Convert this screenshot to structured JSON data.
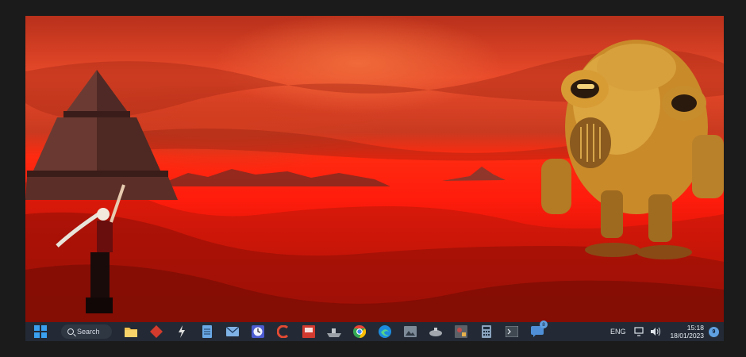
{
  "taskbar": {
    "search_label": "Search",
    "apps": [
      {
        "name": "file-explorer-icon",
        "color": "#f2c14e"
      },
      {
        "name": "red-diamond-app-icon",
        "color": "#d33b2c"
      },
      {
        "name": "lightning-app-icon",
        "color": "#e0e0e0"
      },
      {
        "name": "notepad-icon",
        "color": "#6aa9e6"
      },
      {
        "name": "mail-app-icon",
        "color": "#7fb2e5"
      },
      {
        "name": "clock-app-icon",
        "color": "#4b5bd0"
      },
      {
        "name": "c-logo-app-icon",
        "color": "#e24a33"
      },
      {
        "name": "red-window-app-icon",
        "color": "#d13a2f"
      },
      {
        "name": "ship-app-icon",
        "color": "#9aa0a6"
      },
      {
        "name": "chrome-icon",
        "color": "#34a853"
      },
      {
        "name": "edge-icon",
        "color": "#1c8ce0"
      },
      {
        "name": "image-viewer-icon",
        "color": "#7d8b99"
      },
      {
        "name": "submarine-app-icon",
        "color": "#a2a8ae"
      },
      {
        "name": "paint-app-icon",
        "color": "#c24b4b"
      },
      {
        "name": "calculator-icon",
        "color": "#8aa3bd"
      },
      {
        "name": "terminal-icon",
        "color": "#404852"
      },
      {
        "name": "messages-app-icon",
        "color": "#4e8fd6"
      }
    ],
    "messages_badge": "8",
    "tray": {
      "language": "ENG",
      "time": "15:18",
      "date": "18/01/2023",
      "notifications": "9"
    }
  }
}
